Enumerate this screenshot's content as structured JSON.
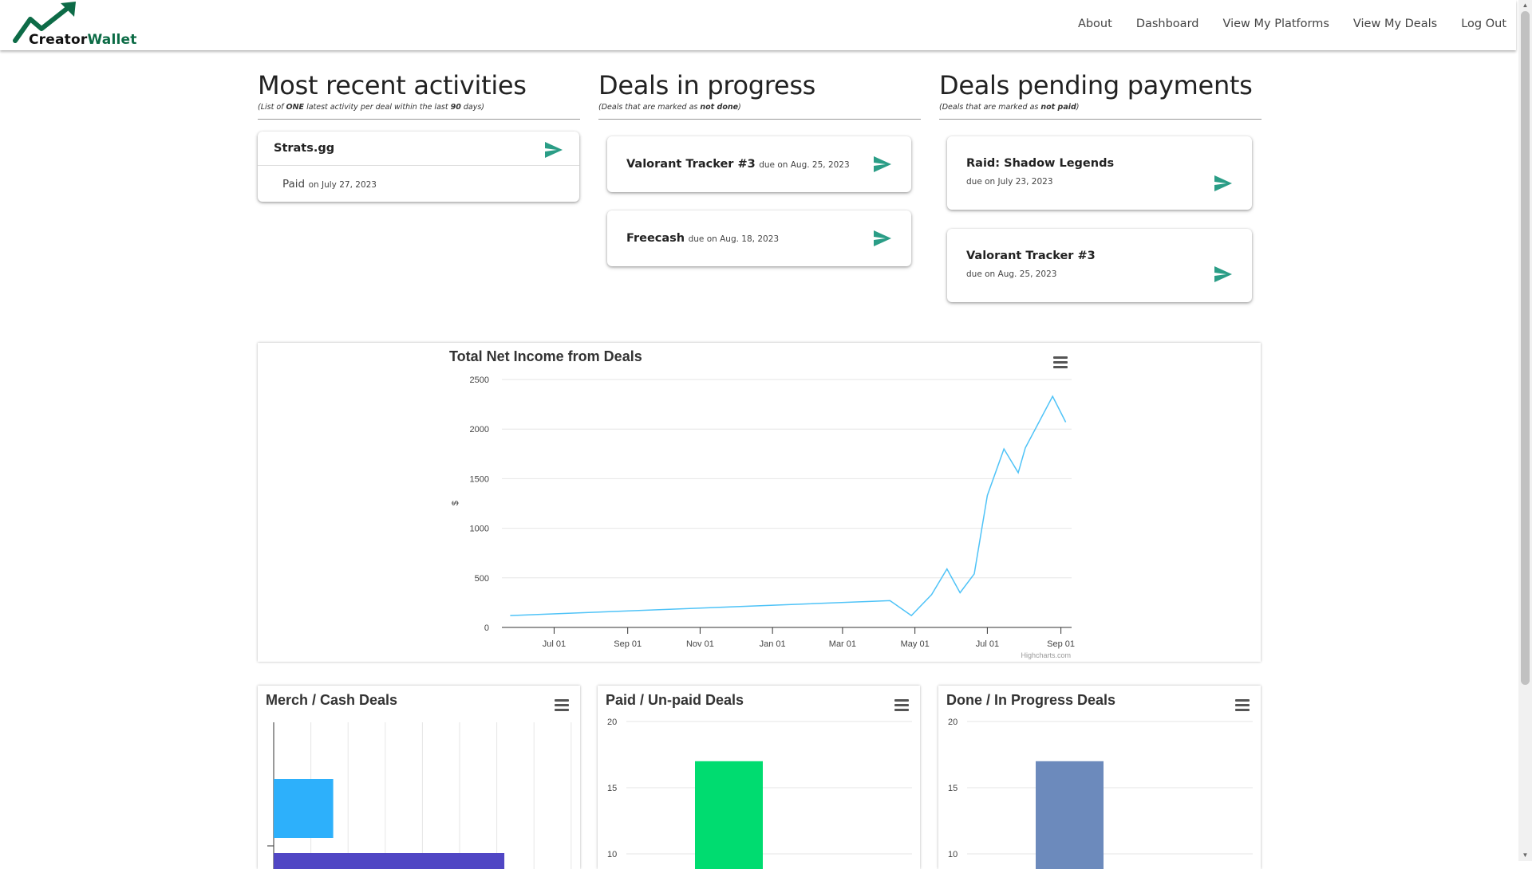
{
  "nav": {
    "logo_text_a": "Creator",
    "logo_text_b": "Wallet",
    "links": [
      "About",
      "Dashboard",
      "View My Platforms",
      "View My Deals",
      "Log Out"
    ]
  },
  "recent": {
    "title": "Most recent activities",
    "sub_a": "(List of ",
    "sub_b": "ONE",
    "sub_c": " latest activity per deal within the last ",
    "sub_d": "90",
    "sub_e": " days)",
    "cards": [
      {
        "name": "Strats.gg",
        "status": "Paid",
        "date": "on July 27, 2023"
      }
    ]
  },
  "progress": {
    "title": "Deals in progress",
    "sub_a": "(Deals that are marked as ",
    "sub_b": "not done",
    "sub_c": ")",
    "cards": [
      {
        "name": "Valorant Tracker #3",
        "due": "due on Aug. 25, 2023"
      },
      {
        "name": "Freecash",
        "due": "due on Aug. 18, 2023"
      }
    ]
  },
  "pending": {
    "title": "Deals pending payments",
    "sub_a": "(Deals that are marked as ",
    "sub_b": "not paid",
    "sub_c": ")",
    "cards": [
      {
        "name": "Raid: Shadow Legends",
        "due": "due on July 23, 2023"
      },
      {
        "name": "Valorant Tracker #3",
        "due": "due on Aug. 25, 2023"
      }
    ]
  },
  "icons": {
    "send": "send-icon",
    "menu": "hamburger-menu-icon"
  },
  "colors": {
    "accent": "#2a9d86",
    "line": "#4fc3f7",
    "merch": "#2db0fb",
    "cash": "#5046c4",
    "paid": "#00dc70",
    "done": "#6c8abc"
  },
  "chart_data": [
    {
      "type": "line",
      "title": "Total Net Income from Deals",
      "ylabel": "$",
      "ylim": [
        0,
        2500
      ],
      "yticks": [
        "0",
        "500",
        "1000",
        "1500",
        "2000",
        "2500"
      ],
      "xticks": [
        "Jul 01",
        "Sep 01",
        "Nov 01",
        "Jan 01",
        "Mar 01",
        "May 01",
        "Jul 01",
        "Sep 01"
      ],
      "credit": "Highcharts.com",
      "x": [
        "2022-05-25",
        "2023-04-10",
        "2023-04-28",
        "2023-05-15",
        "2023-05-28",
        "2023-06-08",
        "2023-06-20",
        "2023-07-01",
        "2023-07-15",
        "2023-07-27",
        "2023-08-02",
        "2023-08-25",
        "2023-09-05"
      ],
      "y": [
        120,
        270,
        120,
        330,
        590,
        350,
        540,
        1330,
        1800,
        1560,
        1810,
        2330,
        2070
      ]
    },
    {
      "type": "bar",
      "title": "Merch / Cash Deals",
      "series": [
        {
          "value": 4
        },
        {
          "value": 15.5
        }
      ]
    },
    {
      "type": "bar",
      "title": "Paid / Un-paid Deals",
      "yticks": [
        "10",
        "15",
        "20"
      ],
      "ylim": [
        0,
        20
      ],
      "values": [
        17
      ]
    },
    {
      "type": "bar",
      "title": "Done / In Progress Deals",
      "yticks": [
        "10",
        "15",
        "20"
      ],
      "ylim": [
        0,
        20
      ],
      "values": [
        17
      ]
    }
  ]
}
